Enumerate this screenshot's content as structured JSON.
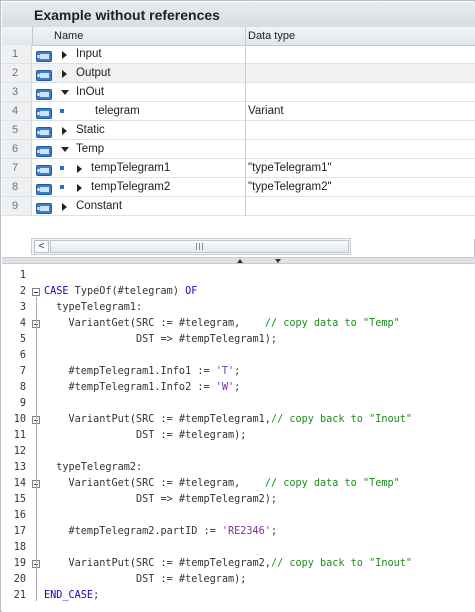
{
  "window": {
    "title": "Example without references"
  },
  "table": {
    "columns": [
      "Name",
      "Data type"
    ],
    "rows": [
      {
        "num": "1",
        "name": "Input",
        "type": "",
        "expander": "collapsed",
        "level": 0
      },
      {
        "num": "2",
        "name": "Output",
        "type": "",
        "expander": "collapsed",
        "level": 0
      },
      {
        "num": "3",
        "name": "InOut",
        "type": "",
        "expander": "expanded",
        "level": 0
      },
      {
        "num": "4",
        "name": "telegram",
        "type": "Variant",
        "expander": "none",
        "level": 1
      },
      {
        "num": "5",
        "name": "Static",
        "type": "",
        "expander": "collapsed",
        "level": 0
      },
      {
        "num": "6",
        "name": "Temp",
        "type": "",
        "expander": "expanded",
        "level": 0
      },
      {
        "num": "7",
        "name": "tempTelegram1",
        "type": "\"typeTelegram1\"",
        "expander": "collapsed",
        "level": 1
      },
      {
        "num": "8",
        "name": "tempTelegram2",
        "type": "\"typeTelegram2\"",
        "expander": "collapsed",
        "level": 1
      },
      {
        "num": "9",
        "name": "Constant",
        "type": "",
        "expander": "collapsed",
        "level": 0
      }
    ]
  },
  "scrollbar": {
    "left_arrow": "<"
  },
  "code": [
    {
      "n": "1",
      "t": ""
    },
    {
      "n": "2",
      "t": "CASE TypeOf(#telegram) OF"
    },
    {
      "n": "3",
      "t": "  typeTelegram1:"
    },
    {
      "n": "4",
      "t": "    VariantGet(SRC := #telegram,    // copy data to \"Temp\""
    },
    {
      "n": "5",
      "t": "               DST => #tempTelegram1);"
    },
    {
      "n": "6",
      "t": ""
    },
    {
      "n": "7",
      "t": "    #tempTelegram1.Info1 := 'T';"
    },
    {
      "n": "8",
      "t": "    #tempTelegram1.Info2 := 'W';"
    },
    {
      "n": "9",
      "t": ""
    },
    {
      "n": "10",
      "t": "    VariantPut(SRC := #tempTelegram1,// copy back to \"Inout\""
    },
    {
      "n": "11",
      "t": "               DST := #telegram);"
    },
    {
      "n": "12",
      "t": ""
    },
    {
      "n": "13",
      "t": "  typeTelegram2:"
    },
    {
      "n": "14",
      "t": "    VariantGet(SRC := #telegram,    // copy data to \"Temp\""
    },
    {
      "n": "15",
      "t": "               DST => #tempTelegram2);"
    },
    {
      "n": "16",
      "t": ""
    },
    {
      "n": "17",
      "t": "    #tempTelegram2.partID := 'RE2346';"
    },
    {
      "n": "18",
      "t": ""
    },
    {
      "n": "19",
      "t": "    VariantPut(SRC := #tempTelegram2,// copy back to \"Inout\""
    },
    {
      "n": "20",
      "t": "               DST := #telegram);"
    },
    {
      "n": "21",
      "t": "END_CASE;"
    }
  ]
}
